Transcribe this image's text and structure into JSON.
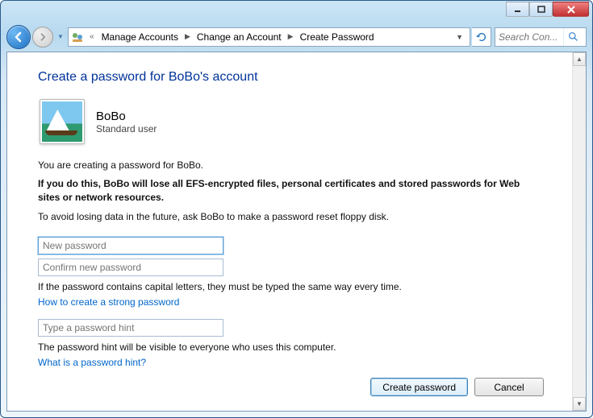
{
  "breadcrumb": {
    "item0": "Manage Accounts",
    "item1": "Change an Account",
    "item2": "Create Password"
  },
  "search": {
    "placeholder": "Search Con..."
  },
  "page": {
    "title": "Create a password for BoBo's account",
    "user_name": "BoBo",
    "user_type": "Standard user",
    "intro": "You are creating a password for BoBo.",
    "warning": "If you do this, BoBo will lose all EFS-encrypted files, personal certificates and stored passwords for Web sites or network resources.",
    "advice": "To avoid losing data in the future, ask BoBo to make a password reset floppy disk.",
    "new_pw_placeholder": "New password",
    "confirm_pw_placeholder": "Confirm new password",
    "caps_note": "If the password contains capital letters, they must be typed the same way every time.",
    "strong_link": "How to create a strong password",
    "hint_placeholder": "Type a password hint",
    "hint_note": "The password hint will be visible to everyone who uses this computer.",
    "hint_link": "What is a password hint?"
  },
  "buttons": {
    "create": "Create password",
    "cancel": "Cancel"
  }
}
